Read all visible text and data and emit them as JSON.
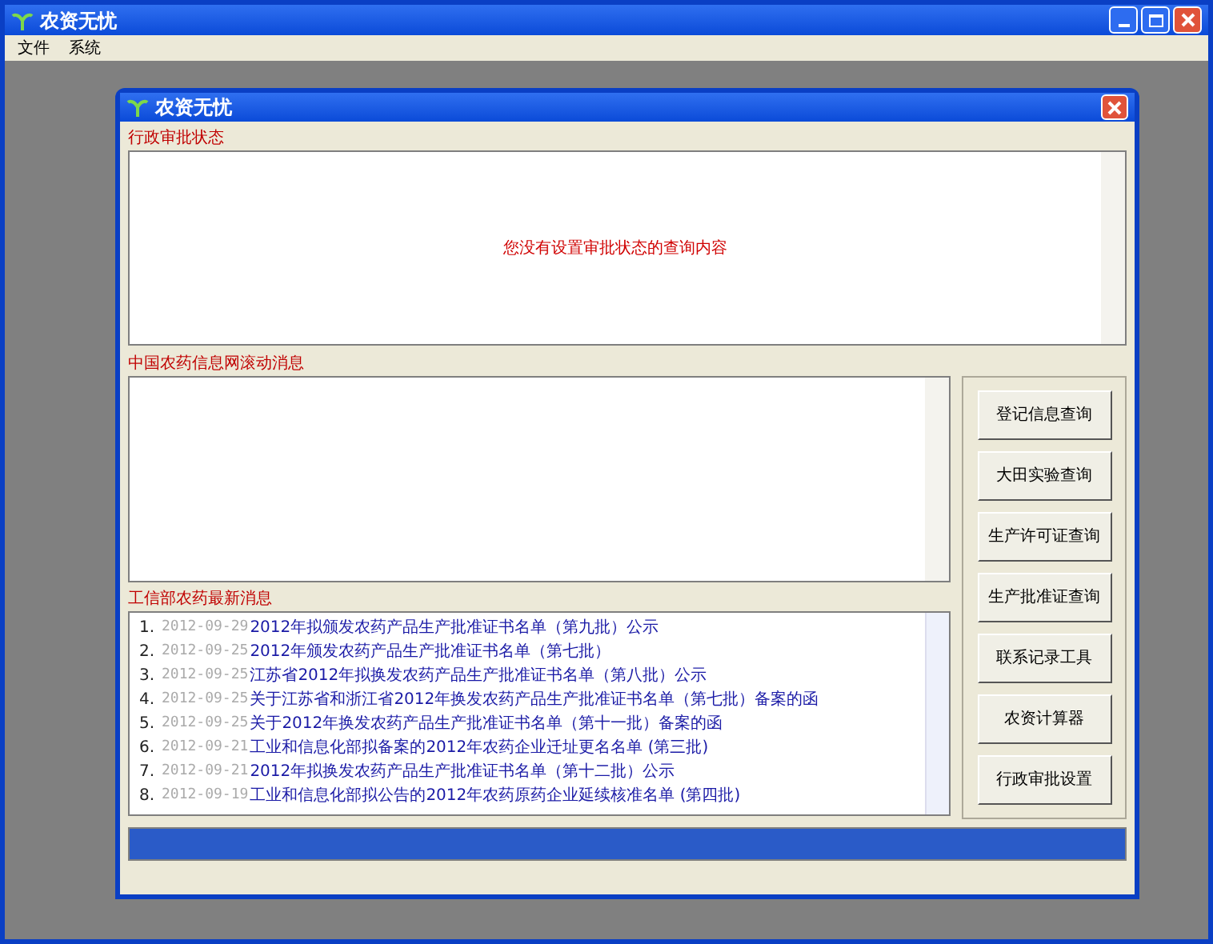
{
  "main_window": {
    "title": "农资无忧",
    "menu": [
      "文件",
      "系统"
    ]
  },
  "dialog": {
    "title": "农资无忧",
    "approval_status": {
      "label": "行政审批状态",
      "message": "您没有设置审批状态的查询内容"
    },
    "scrolling_news": {
      "label": "中国农药信息网滚动消息"
    },
    "latest_news": {
      "label": "工信部农药最新消息",
      "items": [
        {
          "number": "1.",
          "date": "2012-09-29",
          "title": "2012年拟颁发农药产品生产批准证书名单（第九批）公示"
        },
        {
          "number": "2.",
          "date": "2012-09-25",
          "title": "2012年颁发农药产品生产批准证书名单（第七批）"
        },
        {
          "number": "3.",
          "date": "2012-09-25",
          "title": "江苏省2012年拟换发农药产品生产批准证书名单（第八批）公示"
        },
        {
          "number": "4.",
          "date": "2012-09-25",
          "title": "关于江苏省和浙江省2012年换发农药产品生产批准证书名单（第七批）备案的函"
        },
        {
          "number": "5.",
          "date": "2012-09-25",
          "title": "关于2012年换发农药产品生产批准证书名单（第十一批）备案的函"
        },
        {
          "number": "6.",
          "date": "2012-09-21",
          "title": "工业和信息化部拟备案的2012年农药企业迁址更名名单 (第三批)"
        },
        {
          "number": "7.",
          "date": "2012-09-21",
          "title": "2012年拟换发农药产品生产批准证书名单（第十二批）公示"
        },
        {
          "number": "8.",
          "date": "2012-09-19",
          "title": "工业和信息化部拟公告的2012年农药原药企业延续核准名单 (第四批)"
        }
      ]
    },
    "buttons": [
      "登记信息查询",
      "大田实验查询",
      "生产许可证查询",
      "生产批准证查询",
      "联系记录工具",
      "农资计算器",
      "行政审批设置"
    ],
    "progress": {
      "level": 1
    }
  }
}
